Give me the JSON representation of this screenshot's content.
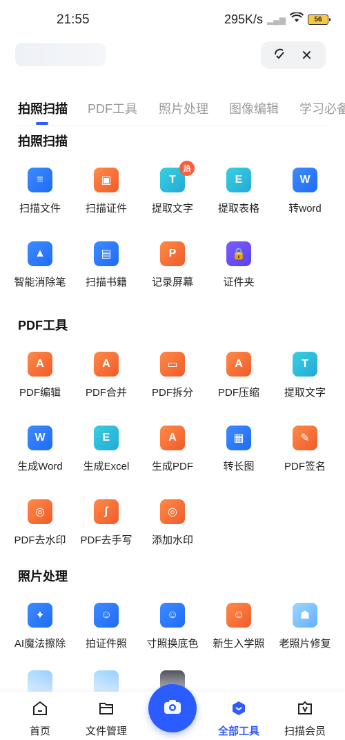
{
  "status_bar": {
    "time": "21:55",
    "speed": "295K/s",
    "battery": "56"
  },
  "tabs": [
    "拍照扫描",
    "PDF工具",
    "照片处理",
    "图像编辑",
    "学习必备"
  ],
  "sections": {
    "scan": {
      "title": "拍照扫描",
      "items": [
        {
          "label": "扫描文件",
          "icon": "scan-file-icon"
        },
        {
          "label": "扫描证件",
          "icon": "scan-id-icon"
        },
        {
          "label": "提取文字",
          "icon": "extract-text-icon",
          "badge": "热"
        },
        {
          "label": "提取表格",
          "icon": "extract-table-icon"
        },
        {
          "label": "转word",
          "icon": "to-word-icon"
        },
        {
          "label": "智能消除笔",
          "icon": "smart-eraser-icon"
        },
        {
          "label": "扫描书籍",
          "icon": "scan-book-icon"
        },
        {
          "label": "记录屏幕",
          "icon": "record-screen-icon"
        },
        {
          "label": "证件夹",
          "icon": "id-folder-icon"
        }
      ]
    },
    "pdf": {
      "title": "PDF工具",
      "items": [
        {
          "label": "PDF编辑",
          "icon": "pdf-edit-icon"
        },
        {
          "label": "PDF合并",
          "icon": "pdf-merge-icon"
        },
        {
          "label": "PDF拆分",
          "icon": "pdf-split-icon"
        },
        {
          "label": "PDF压缩",
          "icon": "pdf-compress-icon"
        },
        {
          "label": "提取文字",
          "icon": "pdf-extract-text-icon"
        },
        {
          "label": "生成Word",
          "icon": "generate-word-icon"
        },
        {
          "label": "生成Excel",
          "icon": "generate-excel-icon"
        },
        {
          "label": "生成PDF",
          "icon": "generate-pdf-icon"
        },
        {
          "label": "转长图",
          "icon": "to-long-image-icon"
        },
        {
          "label": "PDF签名",
          "icon": "pdf-sign-icon"
        },
        {
          "label": "PDF去水印",
          "icon": "pdf-remove-watermark-icon"
        },
        {
          "label": "PDF去手写",
          "icon": "pdf-remove-handwriting-icon"
        },
        {
          "label": "添加水印",
          "icon": "add-watermark-icon"
        }
      ]
    },
    "photo": {
      "title": "照片处理",
      "items": [
        {
          "label": "AI魔法擦除",
          "icon": "ai-magic-erase-icon"
        },
        {
          "label": "拍证件照",
          "icon": "id-photo-icon"
        },
        {
          "label": "寸照换底色",
          "icon": "change-bg-color-icon"
        },
        {
          "label": "新生入学照",
          "icon": "school-photo-icon"
        },
        {
          "label": "老照片修复",
          "icon": "old-photo-repair-icon"
        }
      ]
    }
  },
  "bottom_nav": [
    {
      "label": "首页",
      "icon": "home-icon"
    },
    {
      "label": "文件管理",
      "icon": "folder-icon"
    },
    {
      "label": "全部工具",
      "icon": "all-tools-icon"
    },
    {
      "label": "扫描会员",
      "icon": "vip-icon"
    }
  ],
  "colors": {
    "accent": "#2f5bff",
    "orange": "#ef5b2b",
    "blue": "#1f6bf5"
  }
}
